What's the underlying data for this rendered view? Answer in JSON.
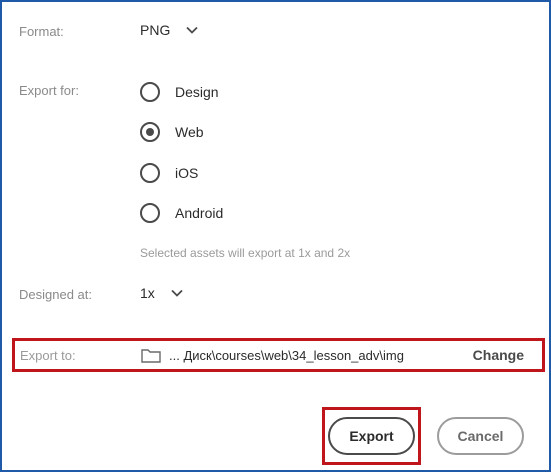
{
  "format": {
    "label": "Format:",
    "selected": "PNG",
    "icon": "chevron-down-icon"
  },
  "export_for": {
    "label": "Export for:",
    "options": [
      {
        "label": "Design",
        "selected": false
      },
      {
        "label": "Web",
        "selected": true
      },
      {
        "label": "iOS",
        "selected": false
      },
      {
        "label": "Android",
        "selected": false
      }
    ],
    "hint": "Selected assets will export at 1x and 2x"
  },
  "designed_at": {
    "label": "Designed at:",
    "selected": "1x",
    "icon": "chevron-down-icon"
  },
  "export_to": {
    "label": "Export to:",
    "icon": "folder-icon",
    "path": "... Диск\\courses\\web\\34_lesson_adv\\img",
    "change_label": "Change"
  },
  "buttons": {
    "export_label": "Export",
    "cancel_label": "Cancel"
  },
  "colors": {
    "highlight": "#c0151b",
    "window_border": "#1f5aa8",
    "control": "#4a4a4a"
  }
}
